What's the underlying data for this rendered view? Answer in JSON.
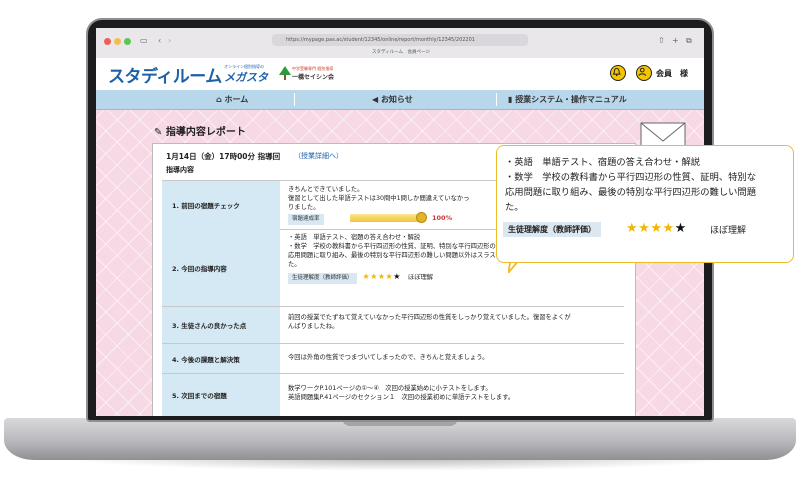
{
  "browser": {
    "url": "https://mypage.pas.ac/student/12345/online/report/monthly/12345/202201",
    "tab_title": "スタディルーム　会員ページ"
  },
  "header": {
    "logo": "スタディルーム",
    "brand_tagline": "オンライン個別指導の",
    "brand": "メガスタ",
    "partner_tagline": "中学受験専門 個別指導",
    "partner": "一橋セイシン会",
    "user_label": "会員　様"
  },
  "nav": {
    "home": "ホーム",
    "news": "お知らせ",
    "manual": "授業システム・操作マニュアル"
  },
  "report": {
    "title": "指導内容レポート",
    "lesson_header": "1月14日（金）17時00分 指導回",
    "detail_link": "（授業詳細へ）",
    "section_label": "指導内容",
    "rows": [
      {
        "label": "1. 前回の宿題チェック",
        "lines": [
          "きちんとできていました。",
          "復習として出した単語テストは30問中1問しか間違えていなかっ",
          "りました。"
        ],
        "bar_label": "宿題達成率",
        "percent_text": "100%",
        "completion": 1.0
      },
      {
        "label": "2. 今回の指導内容",
        "lines": [
          "・英語　単語テスト、宿題の答え合わせ・解説",
          "・数学　学校の教科書から平行四辺形の性質、証明、特別な平行四辺形の復習",
          "応用問題に取り組み、最後の特別な平行四辺形の難しい問題以外はスラスラと解けるようになりまし",
          "た。"
        ],
        "eval_label": "生徒理解度（教師評価）",
        "eval_text": "ほぼ理解",
        "rating": 4,
        "rating_max": 5
      },
      {
        "label": "3. 生徒さんの良かった点",
        "lines": [
          "前回の授業でたずねて覚えていなかった平行四辺形の性質をしっかり覚えていました。復習をよくが",
          "んばりましたね。"
        ]
      },
      {
        "label": "4. 今後の課題と解決策",
        "lines": [
          "今回は外角の性質でつまづいてしまったので、きちんと覚えましょう。"
        ]
      },
      {
        "label": "5. 次回までの宿題",
        "lines": [
          "数学ワークP.101ページの①〜④　次回の授業始めに小テストをします。",
          "英語問題集P.41ページのセクション１　次回の授業初めに単語テストをします。"
        ]
      }
    ]
  },
  "callout": {
    "lines": [
      "・英語　単語テスト、宿題の答え合わせ・解説",
      "・数学　学校の教科書から平行四辺形の性質、証明、特別な",
      "応用問題に取り組み、最後の特別な平行四辺形の難しい問題",
      "た。"
    ],
    "eval_label": "生徒理解度（教師評価）",
    "eval_text": "ほぼ理解",
    "rating": 4,
    "rating_max": 5
  },
  "colors": {
    "brand_blue": "#1e60a8",
    "nav_bg": "#b8d7ea",
    "content_bg": "#f7d9e6",
    "callout_border": "#f0bb2a",
    "star": "#f2b600",
    "percent_red": "#d0342c"
  },
  "icons": [
    "home-icon",
    "megaphone-icon",
    "book-icon",
    "bell-icon",
    "user-icon",
    "report-icon",
    "medal-icon",
    "star-icon"
  ]
}
